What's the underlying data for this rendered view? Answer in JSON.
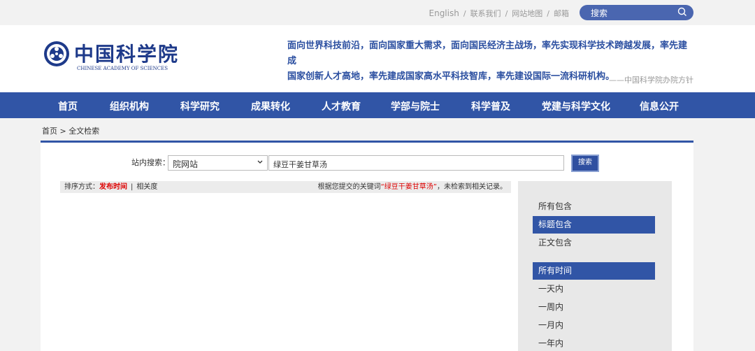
{
  "top": {
    "links": [
      "English",
      "联系我们",
      "网站地图",
      "邮箱"
    ],
    "search_label": "搜索"
  },
  "header": {
    "logo_cn": "中国科学院",
    "logo_en": "CHINESE ACADEMY OF SCIENCES",
    "slogan_line1": "面向世界科技前沿，面向国家重大需求，面向国民经济主战场，率先实现科学技术跨越发展，率先建成",
    "slogan_line2": "国家创新人才高地，率先建成国家高水平科技智库，率先建设国际一流科研机构。",
    "slogan_source": "——中国科学院办院方针"
  },
  "nav": {
    "items": [
      "首页",
      "组织机构",
      "科学研究",
      "成果转化",
      "人才教育",
      "学部与院士",
      "科学普及",
      "党建与科学文化",
      "信息公开"
    ]
  },
  "breadcrumb": "首页 > 全文检索",
  "search": {
    "label": "站内搜索：",
    "scope": "院网站",
    "query": "绿豆干姜甘草汤",
    "button": "搜索"
  },
  "results": {
    "sort_label": "排序方式：",
    "sort_time": "发布时间",
    "sort_relevance": "相关度",
    "msg_prefix": "根据您提交的关键词",
    "msg_keyword": "“绿豆干姜甘草汤”",
    "msg_suffix": "，未检索到相关记录。"
  },
  "filters": {
    "match": [
      "所有包含",
      "标题包含",
      "正文包含"
    ],
    "time": [
      "所有时间",
      "一天内",
      "一周内",
      "一月内",
      "一年内"
    ]
  },
  "colors": {
    "brand_blue": "#3155a6",
    "highlight_red": "#dd0000"
  }
}
